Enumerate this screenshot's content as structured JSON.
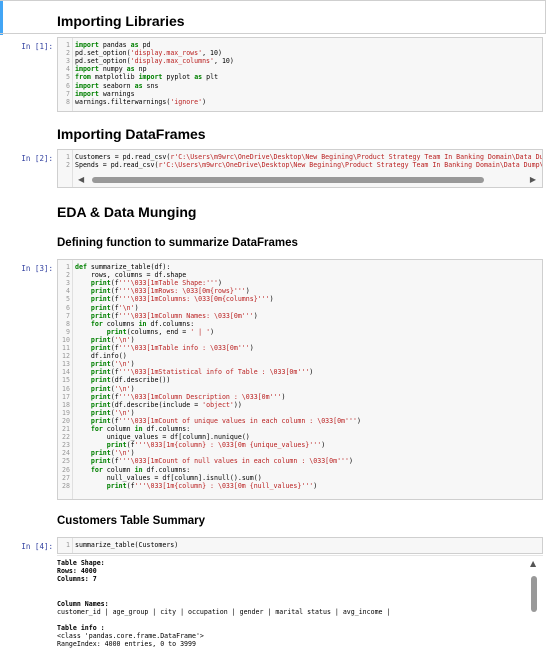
{
  "headings": {
    "importing_libraries": "Importing Libraries",
    "importing_dataframes": "Importing DataFrames",
    "eda": "EDA & Data Munging",
    "defining_function": "Defining function to summarize DataFrames",
    "customers_summary": "Customers Table Summary"
  },
  "prompts": {
    "in1": "In [1]:",
    "in2": "In [2]:",
    "in3": "In [3]:",
    "in4": "In [4]:"
  },
  "cell1_lines": [
    "import pandas as pd",
    "pd.set_option('display.max_rows', 10)",
    "pd.set_option('display.max_columns', 10)",
    "import numpy as np",
    "from matplotlib import pyplot as plt",
    "import seaborn as sns",
    "import warnings",
    "warnings.filterwarnings('ignore')"
  ],
  "cell2_lines": [
    "Customers = pd.read_csv(r'C:\\Users\\m9wrc\\OneDrive\\Desktop\\New Begining\\Product Strategy Team In Banking Domain\\Data Dump\\dim",
    "Spends = pd.read_csv(r'C:\\Users\\m9wrc\\OneDrive\\Desktop\\New Begining\\Product Strategy Team In Banking Domain\\Data Dump\\fact_s"
  ],
  "cell3_lines": [
    "def summarize_table(df):",
    "    rows, columns = df.shape",
    "    print(f'''\\033[1mTable Shape:''')",
    "    print(f'''\\033[1mRows: \\033[0m{rows}''')",
    "    print(f'''\\033[1mColumns: \\033[0m{columns}''')",
    "    print(f'\\n')",
    "    print(f'''\\033[1mColumn Names: \\033[0m''')",
    "    for columns in df.columns:",
    "        print(columns, end = ' | ')",
    "    print('\\n')",
    "    print(f'''\\033[1mTable info : \\033[0m''')",
    "    df.info()",
    "    print('\\n')",
    "    print(f'''\\033[1mStatistical info of Table : \\033[0m''')",
    "    print(df.describe())",
    "    print('\\n')",
    "    print(f'''\\033[1mColumn Description : \\033[0m''')",
    "    print(df.describe(include = 'object'))",
    "    print('\\n')",
    "    print(f'''\\033[1mCount of unique values in each column : \\033[0m''')",
    "    for column in df.columns:",
    "        unique_values = df[column].nunique()",
    "        print(f'''\\033[1m{column} : \\033[0m {unique_values}''')",
    "    print('\\n')",
    "    print(f'''\\033[1mCount of null values in each column : \\033[0m''')",
    "    for column in df.columns:",
    "        null_values = df[column].isnull().sum()",
    "        print(f'''\\033[1m{column} : \\033[0m {null_values}''')"
  ],
  "cell4_lines": [
    "summarize_table(Customers)"
  ],
  "output_lines": [
    "Table Shape:",
    "Rows: 4000",
    "Columns: 7",
    "",
    "",
    "Column Names:",
    "customer_id | age_group | city | occupation | gender | marital status | avg_income |",
    "",
    "Table info :",
    "<class 'pandas.core.frame.DataFrame'>",
    "RangeIndex: 4000 entries, 0 to 3999"
  ],
  "icons": {
    "scroll_left": "left-arrow-icon",
    "scroll_right": "right-arrow-icon",
    "scroll_up": "up-arrow-icon"
  },
  "colors": {
    "keyword": "#008000",
    "string": "#ba2121",
    "prompt": "#303f9f",
    "selection": "#42a5f5"
  }
}
